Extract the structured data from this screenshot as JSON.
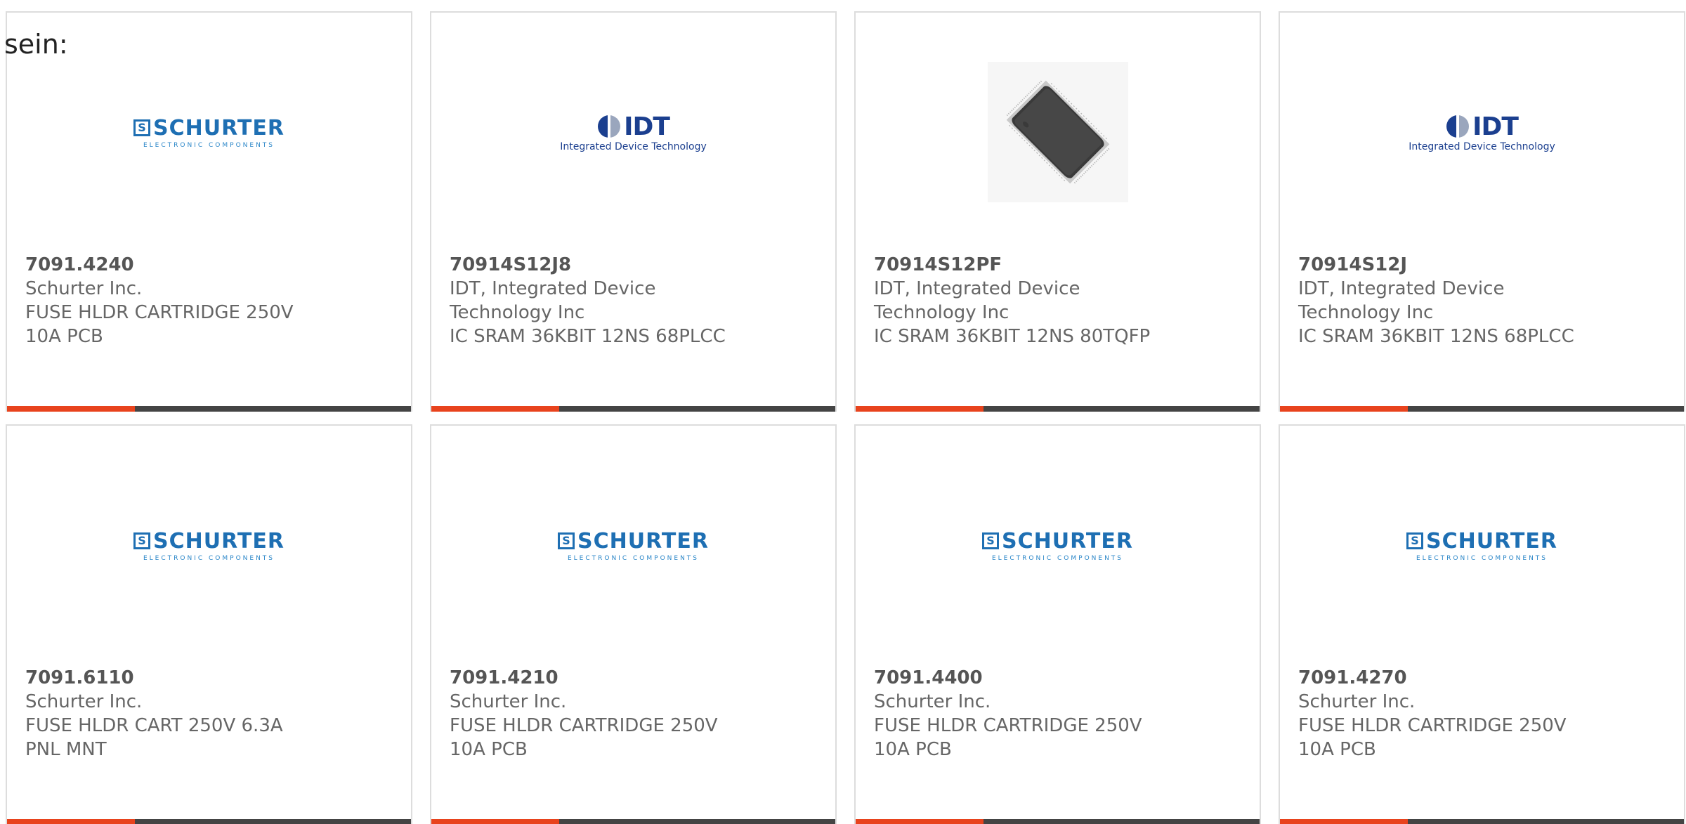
{
  "intro_text": "sein:",
  "colors": {
    "accent": "#e8431d",
    "bar_dark": "#444444",
    "schurter_blue": "#1e6fb3",
    "idt_blue": "#1b3f8f"
  },
  "logos": {
    "schurter": {
      "mark": "S",
      "word": "SCHURTER",
      "sub": "ELECTRONIC COMPONENTS"
    },
    "idt": {
      "word": "IDT",
      "sub": "Integrated Device Technology"
    }
  },
  "products": [
    {
      "part_number": "7091.4240",
      "manufacturer": "Schurter Inc.",
      "description": "FUSE HLDR CARTRIDGE 250V 10A PCB",
      "image": "schurter-logo"
    },
    {
      "part_number": "70914S12J8",
      "manufacturer": "IDT, Integrated Device Technology Inc",
      "description": "IC SRAM 36KBIT 12NS 68PLCC",
      "image": "idt-logo"
    },
    {
      "part_number": "70914S12PF",
      "manufacturer": "IDT, Integrated Device Technology Inc",
      "description": "IC SRAM 36KBIT 12NS 80TQFP",
      "image": "chip-photo"
    },
    {
      "part_number": "70914S12J",
      "manufacturer": "IDT, Integrated Device Technology Inc",
      "description": "IC SRAM 36KBIT 12NS 68PLCC",
      "image": "idt-logo"
    },
    {
      "part_number": "7091.6110",
      "manufacturer": "Schurter Inc.",
      "description": "FUSE HLDR CART 250V 6.3A PNL MNT",
      "image": "schurter-logo"
    },
    {
      "part_number": "7091.4210",
      "manufacturer": "Schurter Inc.",
      "description": "FUSE HLDR CARTRIDGE 250V 10A PCB",
      "image": "schurter-logo"
    },
    {
      "part_number": "7091.4400",
      "manufacturer": "Schurter Inc.",
      "description": "FUSE HLDR CARTRIDGE 250V 10A PCB",
      "image": "schurter-logo"
    },
    {
      "part_number": "7091.4270",
      "manufacturer": "Schurter Inc.",
      "description": "FUSE HLDR CARTRIDGE 250V 10A PCB",
      "image": "schurter-logo"
    }
  ]
}
